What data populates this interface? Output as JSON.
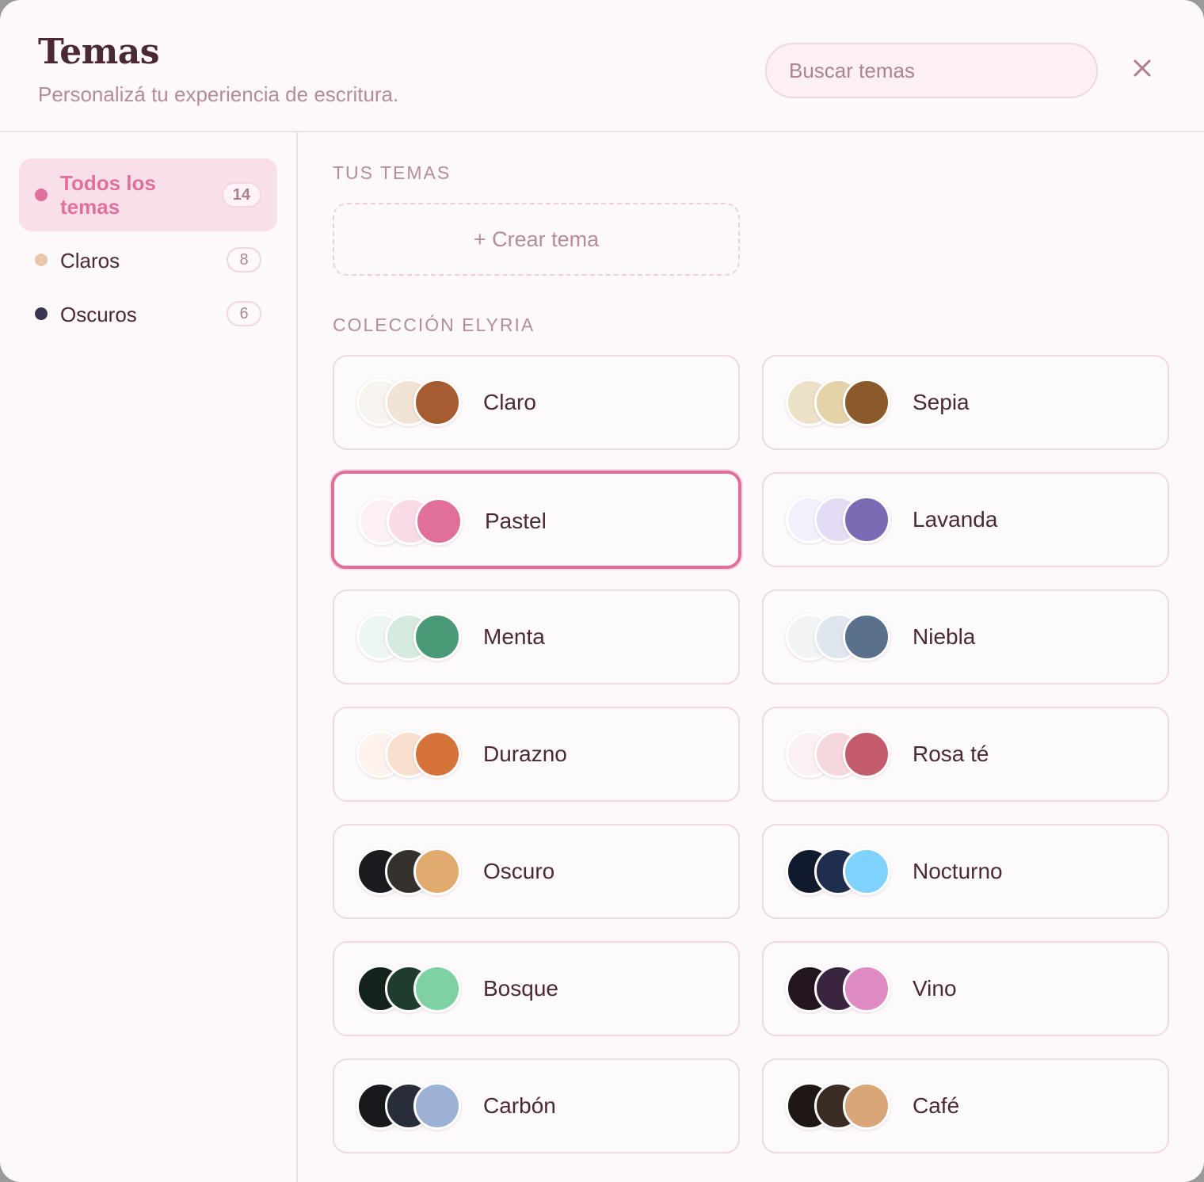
{
  "header": {
    "title": "Temas",
    "subtitle": "Personalizá tu experiencia de escritura.",
    "search_placeholder": "Buscar temas",
    "close_icon": "close-icon"
  },
  "sidebar": {
    "items": [
      {
        "label": "Todos los temas",
        "count": "14",
        "dot_color": "#e0709b",
        "active": true
      },
      {
        "label": "Claros",
        "count": "8",
        "dot_color": "#e8c8a8",
        "active": false
      },
      {
        "label": "Oscuros",
        "count": "6",
        "dot_color": "#3a3550",
        "active": false
      }
    ]
  },
  "main": {
    "your_themes_label": "TUS TEMAS",
    "create_label": "+ Crear tema",
    "collection_label": "COLECCIÓN ELYRIA",
    "themes": [
      {
        "name": "Claro",
        "colors": [
          "#f7f3ee",
          "#f0e2d4",
          "#a45c30"
        ],
        "selected": false
      },
      {
        "name": "Sepia",
        "colors": [
          "#ece0c7",
          "#e4d3a8",
          "#8a5a2b"
        ],
        "selected": false
      },
      {
        "name": "Pastel",
        "colors": [
          "#fdf0f6",
          "#f9dbe7",
          "#e0709b"
        ],
        "selected": true
      },
      {
        "name": "Lavanda",
        "colors": [
          "#f3f0fb",
          "#e4dcf5",
          "#7d6ab4"
        ],
        "selected": false
      },
      {
        "name": "Menta",
        "colors": [
          "#edf6f0",
          "#d6eadf",
          "#4a9a77"
        ],
        "selected": false
      },
      {
        "name": "Niebla",
        "colors": [
          "#f1f3f5",
          "#dfe6ee",
          "#5a708a"
        ],
        "selected": false
      },
      {
        "name": "Durazno",
        "colors": [
          "#fdf3ec",
          "#f9dfd0",
          "#d5733a"
        ],
        "selected": false
      },
      {
        "name": "Rosa té",
        "colors": [
          "#fbf0f2",
          "#f5d8de",
          "#c45b6c"
        ],
        "selected": false
      },
      {
        "name": "Oscuro",
        "colors": [
          "#1b1a1f",
          "#34302b",
          "#e1aa6e"
        ],
        "selected": false
      },
      {
        "name": "Nocturno",
        "colors": [
          "#111a2c",
          "#1f2d4f",
          "#7fd2fb"
        ],
        "selected": false
      },
      {
        "name": "Bosque",
        "colors": [
          "#13231b",
          "#1f3d2d",
          "#7fd1a2"
        ],
        "selected": false
      },
      {
        "name": "Vino",
        "colors": [
          "#22151f",
          "#3a2440",
          "#e08cc4"
        ],
        "selected": false
      },
      {
        "name": "Carbón",
        "colors": [
          "#17181c",
          "#282d3a",
          "#9db1d5"
        ],
        "selected": false
      },
      {
        "name": "Café",
        "colors": [
          "#1e1713",
          "#3a2b23",
          "#d9a679"
        ],
        "selected": false
      }
    ]
  },
  "colors": {
    "accent": "#e0709b",
    "text": "#4a2934",
    "muted": "#b48d9b",
    "background": "#fdf8fa"
  }
}
